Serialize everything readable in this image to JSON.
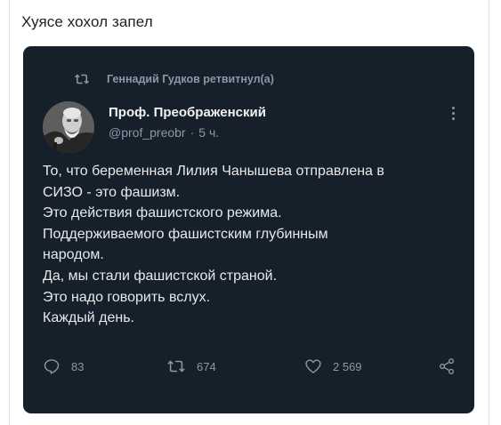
{
  "post": {
    "caption": "Хуясе хохол запел"
  },
  "tweet": {
    "retweeted_by": "Геннадий Гудков ретвитнул(а)",
    "author_name": "Проф. Преображенский",
    "author_handle": "@prof_preobr",
    "separator": "·",
    "time_ago": "5 ч.",
    "text_lines": [
      "То, что беременная Лилия Чанышева отправлена в",
      "СИЗО - это фашизм.",
      "Это действия фашистского режима.",
      "Поддерживаемого фашистским глубинным",
      "народом.",
      "Да, мы стали фашистской страной.",
      "Это надо говорить вслух.",
      "Каждый день."
    ],
    "actions": {
      "replies": "83",
      "retweets": "674",
      "likes": "2 569"
    }
  },
  "icons": {
    "retweet_header": "retweet-icon",
    "reply": "reply-icon",
    "retweet": "retweet-icon",
    "like": "heart-icon",
    "share": "share-icon",
    "more": "more-icon"
  },
  "colors": {
    "card_background": "#15202b",
    "primary_text": "#e7e9ea",
    "secondary_text": "#8b98a5"
  }
}
